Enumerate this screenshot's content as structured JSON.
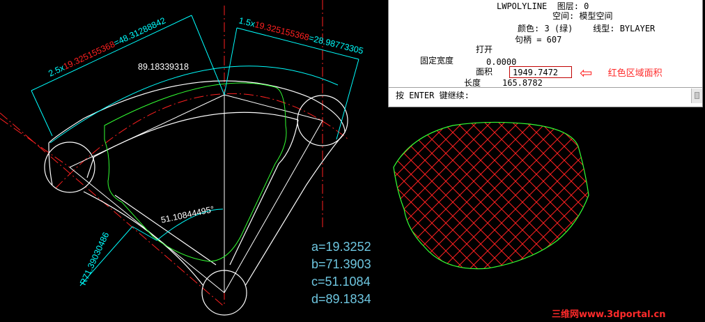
{
  "colors": {
    "background": "#000000",
    "geometry": "#ffffff",
    "dimension": "#00ffff",
    "centerline": "#ff2020",
    "offset_profile": "#33ff33",
    "hatch": "#ff2020",
    "highlight_value": "#ff2a2a"
  },
  "drawing": {
    "dim_top_left": {
      "prefix": "2.5x",
      "value": "19.325155368",
      "suffix": "=48.31288842"
    },
    "dim_top_right": {
      "prefix": "1.5x",
      "value": "19.325155368",
      "suffix": "=28.98773305"
    },
    "dim_arc_top": "89.18339318",
    "dim_angle": "51.10844495°",
    "dim_radius": "R71.39030486",
    "params": [
      "a=19.3252",
      "b=71.3903",
      "c=51.1084",
      "d=89.1834"
    ]
  },
  "list_window": {
    "lines": [
      "LWPOLYLINE  图层: 0",
      "空间: 模型空间",
      "颜色: 3 (绿)    线型: BYLAYER",
      "句柄 = 607",
      "打开",
      "固定宽度",
      "0.0000",
      "面积",
      "1949.7472",
      "长度",
      "165.8782"
    ],
    "command_prompt": "按 ENTER 键继续:"
  },
  "annotation": {
    "arrow": "⇦",
    "text": "红色区域面积"
  },
  "watermark": "三维网www.3dportal.cn"
}
